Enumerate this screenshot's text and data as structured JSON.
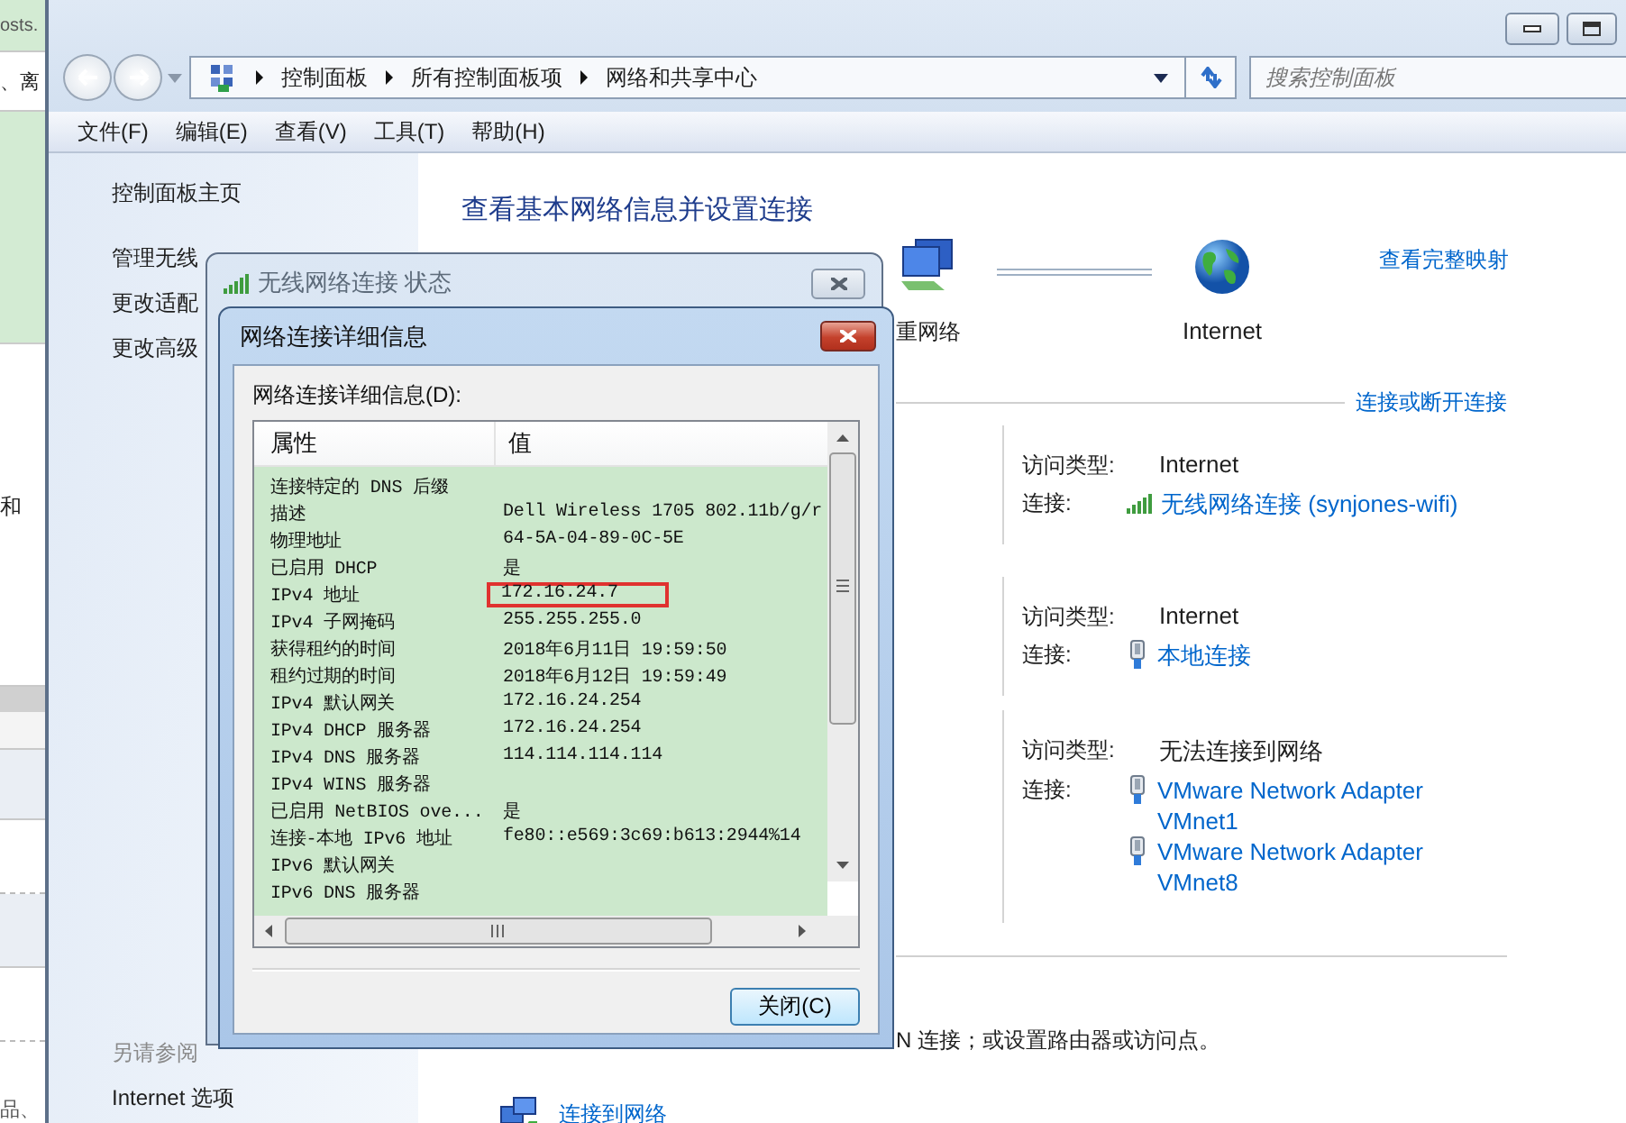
{
  "background_window": {
    "texts": [
      "osts.",
      "、离",
      "和",
      "品、"
    ]
  },
  "address_bar": {
    "breadcrumbs": [
      "控制面板",
      "所有控制面板项",
      "网络和共享中心"
    ]
  },
  "search": {
    "placeholder": "搜索控制面板"
  },
  "menu": [
    "文件(F)",
    "编辑(E)",
    "查看(V)",
    "工具(T)",
    "帮助(H)"
  ],
  "sidebar": {
    "items": [
      "控制面板主页",
      "管理无线",
      "更改适配",
      "更改高级"
    ],
    "see_also_title": "另请参阅",
    "see_also_items": [
      "Internet 选项"
    ]
  },
  "main": {
    "heading": "查看基本网络信息并设置连接",
    "network_map": {
      "nodes": [
        {
          "kind": "computer",
          "label": "重网络"
        },
        {
          "kind": "globe",
          "label": "Internet"
        }
      ],
      "full_map_link": "查看完整映射"
    },
    "connect_link": "连接或断开连接",
    "networks": [
      {
        "access_label": "访问类型:",
        "access_value": "Internet",
        "connection_label": "连接:",
        "connections": [
          {
            "kind": "wireless",
            "name": "无线网络连接 (synjones-wifi)"
          }
        ]
      },
      {
        "access_label": "访问类型:",
        "access_value": "Internet",
        "connection_label": "连接:",
        "connections": [
          {
            "kind": "wired",
            "name": "本地连接"
          }
        ]
      },
      {
        "access_label": "访问类型:",
        "access_value": "无法连接到网络",
        "connection_label": "连接:",
        "connections": [
          {
            "kind": "wired",
            "name": "VMware Network Adapter VMnet1"
          },
          {
            "kind": "wired",
            "name": "VMware Network Adapter VMnet8"
          }
        ]
      }
    ],
    "tasks_text": "N 连接；或设置路由器或访问点。",
    "tasks": [
      "连接到网络"
    ]
  },
  "status_dialog": {
    "title": "无线网络连接 状态"
  },
  "details_dialog": {
    "title": "网络连接详细信息",
    "list_label": "网络连接详细信息(D):",
    "columns": [
      "属性",
      "值"
    ],
    "rows": [
      {
        "property": "连接特定的 DNS 后缀",
        "highlighted": false
      },
      {
        "property": "描述",
        "value": "Dell Wireless 1705 802.11b/g/r",
        "highlighted": false
      },
      {
        "property": "物理地址",
        "value": "64-5A-04-89-0C-5E",
        "highlighted": false
      },
      {
        "property": "已启用 DHCP",
        "value": "是",
        "highlighted": false
      },
      {
        "property": "IPv4 地址",
        "value": "172.16.24.7",
        "highlighted": true
      },
      {
        "property": "IPv4 子网掩码",
        "value": "255.255.255.0",
        "highlighted": false
      },
      {
        "property": "获得租约的时间",
        "value": "2018年6月11日 19:59:50",
        "highlighted": false
      },
      {
        "property": "租约过期的时间",
        "value": "2018年6月12日 19:59:49",
        "highlighted": false
      },
      {
        "property": "IPv4 默认网关",
        "value": "172.16.24.254",
        "highlighted": false
      },
      {
        "property": "IPv4 DHCP 服务器",
        "value": "172.16.24.254",
        "highlighted": false
      },
      {
        "property": "IPv4 DNS 服务器",
        "value": "114.114.114.114",
        "highlighted": false
      },
      {
        "property": "IPv4 WINS 服务器",
        "highlighted": false
      },
      {
        "property": "已启用 NetBIOS ove...",
        "value": "是",
        "highlighted": false
      },
      {
        "property": "连接-本地 IPv6 地址",
        "value": "fe80::e569:3c69:b613:2944%14",
        "highlighted": false
      },
      {
        "property": "IPv6 默认网关",
        "highlighted": false
      },
      {
        "property": "IPv6 DNS 服务器",
        "highlighted": false
      }
    ],
    "close_button": "关闭(C)"
  }
}
